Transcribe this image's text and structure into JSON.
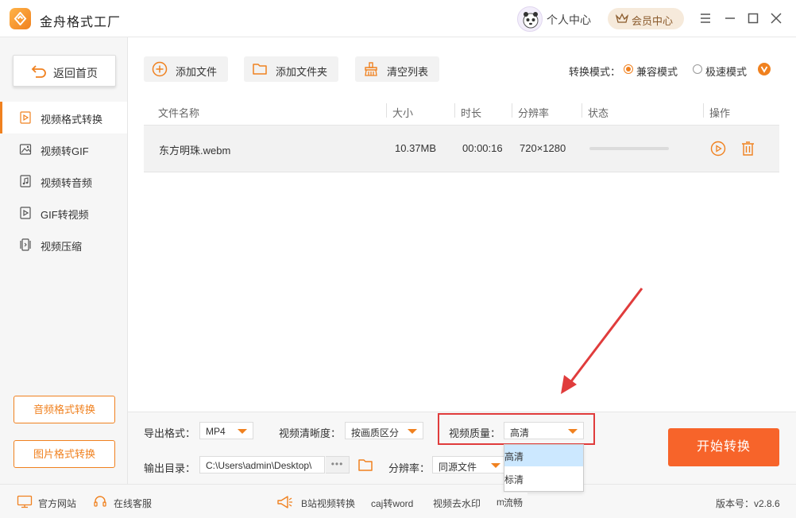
{
  "app": {
    "title": "金舟格式工厂"
  },
  "header": {
    "personal_center": "个人中心",
    "vip_center": "会员中心"
  },
  "sidebar": {
    "home": "返回首页",
    "items": [
      {
        "label": "视频格式转换",
        "icon": "video-file-icon",
        "active": true
      },
      {
        "label": "视频转GIF",
        "icon": "image-icon",
        "active": false
      },
      {
        "label": "视频转音频",
        "icon": "music-file-icon",
        "active": false
      },
      {
        "label": "GIF转视频",
        "icon": "play-file-icon",
        "active": false
      },
      {
        "label": "视频压缩",
        "icon": "compress-icon",
        "active": false
      }
    ],
    "audio_convert": "音频格式转换",
    "image_convert": "图片格式转换"
  },
  "toolbar": {
    "add_file": "添加文件",
    "add_folder": "添加文件夹",
    "clear_list": "清空列表",
    "mode_label": "转换模式：",
    "mode_compat": "兼容模式",
    "mode_fast": "极速模式",
    "selected_mode": "兼容模式"
  },
  "table": {
    "columns": [
      "文件名称",
      "大小",
      "时长",
      "分辨率",
      "状态",
      "操作"
    ],
    "rows": [
      {
        "name": "东方明珠.webm",
        "size": "10.37MB",
        "duration": "00:00:16",
        "resolution": "720×1280",
        "progress": 0
      }
    ]
  },
  "settings": {
    "export_format_label": "导出格式：",
    "export_format": "MP4",
    "clarity_label": "视频清晰度：",
    "clarity": "按画质区分",
    "quality_label": "视频质量：",
    "quality": "高清",
    "quality_options": [
      "高清",
      "标清",
      "流畅"
    ],
    "output_dir_label": "输出目录：",
    "output_dir": "C:\\Users\\admin\\Desktop\\",
    "more": "•••",
    "resolution_label": "分辨率：",
    "resolution": "同源文件",
    "start": "开始转换"
  },
  "statusbar": {
    "website": "官方网站",
    "support": "在线客服",
    "bilibili": "B站视频转换",
    "caj": "caj转word",
    "watermark": "视频去水印",
    "last_fragment": "m",
    "version": "版本号：v2.8.6"
  },
  "colors": {
    "accent": "#f0811f",
    "start_button": "#f7642a",
    "highlight": "#e03c3c"
  }
}
